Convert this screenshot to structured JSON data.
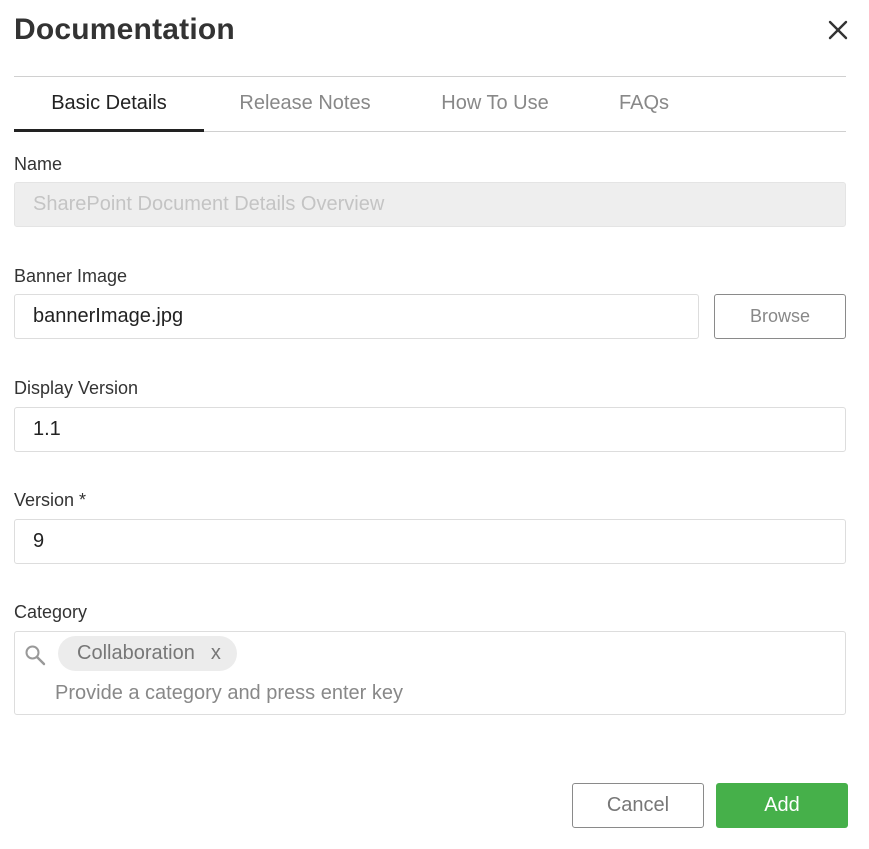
{
  "dialog": {
    "title": "Documentation",
    "close_icon": "close-icon"
  },
  "tabs": [
    {
      "label": "Basic Details",
      "active": true
    },
    {
      "label": "Release Notes",
      "active": false
    },
    {
      "label": "How To Use",
      "active": false
    },
    {
      "label": "FAQs",
      "active": false
    }
  ],
  "form": {
    "name": {
      "label": "Name",
      "value": "SharePoint Document Details Overview",
      "disabled": true
    },
    "banner_image": {
      "label": "Banner Image",
      "value": "bannerImage.jpg",
      "browse_label": "Browse"
    },
    "display_version": {
      "label": "Display Version",
      "value": "1.1"
    },
    "version": {
      "label": "Version *",
      "value": "9"
    },
    "category": {
      "label": "Category",
      "search_icon": "search-icon",
      "chips": [
        {
          "label": "Collaboration",
          "remove_label": "x"
        }
      ],
      "placeholder": "Provide a category and press enter key"
    }
  },
  "footer": {
    "cancel_label": "Cancel",
    "add_label": "Add"
  },
  "colors": {
    "primary": "#46b04a",
    "text": "#333333",
    "muted": "#888888",
    "border": "#dddddd",
    "disabled_bg": "#eeeeee"
  }
}
